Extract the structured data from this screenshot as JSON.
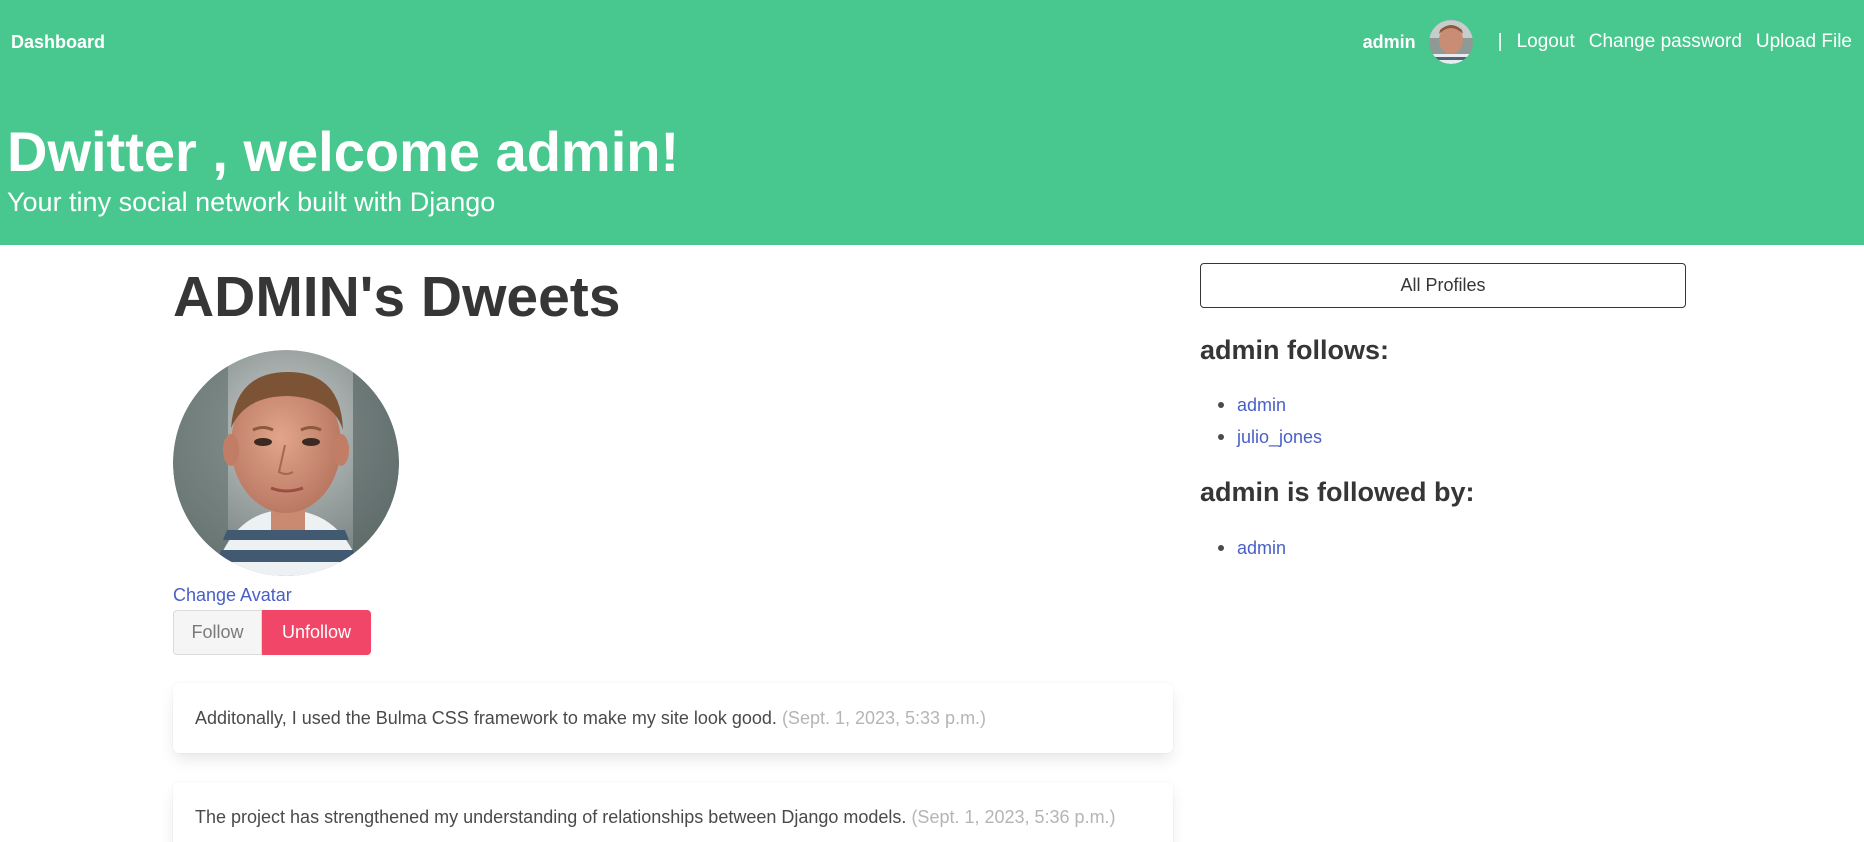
{
  "navbar": {
    "brand": "Dashboard",
    "username": "admin",
    "separator": "|",
    "links": [
      "Logout",
      "Change password",
      "Upload File"
    ]
  },
  "hero": {
    "title": "Dwitter , welcome admin!",
    "subtitle": "Your tiny social network built with Django"
  },
  "profile": {
    "title": "ADMIN's Dweets",
    "change_avatar": "Change Avatar",
    "follow_label": "Follow",
    "unfollow_label": "Unfollow"
  },
  "dweets": [
    {
      "text": "Additonally, I used the Bulma CSS framework to make my site look good.",
      "date": "(Sept. 1, 2023, 5:33 p.m.)"
    },
    {
      "text": "The project has strengthened my understanding of relationships between Django models.",
      "date": "(Sept. 1, 2023, 5:36 p.m.)"
    }
  ],
  "sidebar": {
    "all_profiles": "All Profiles",
    "follows_heading": "admin follows:",
    "follows": [
      "admin",
      "julio_jones"
    ],
    "followed_heading": "admin is followed by:",
    "followed_by": [
      "admin"
    ]
  },
  "colors": {
    "hero_bg": "#48c78e",
    "link": "#485fc7",
    "unfollow": "#f14668",
    "date": "#b5b5b5"
  },
  "icons": {
    "nav_avatar": "user-avatar-photo",
    "profile_avatar": "user-avatar-photo"
  }
}
